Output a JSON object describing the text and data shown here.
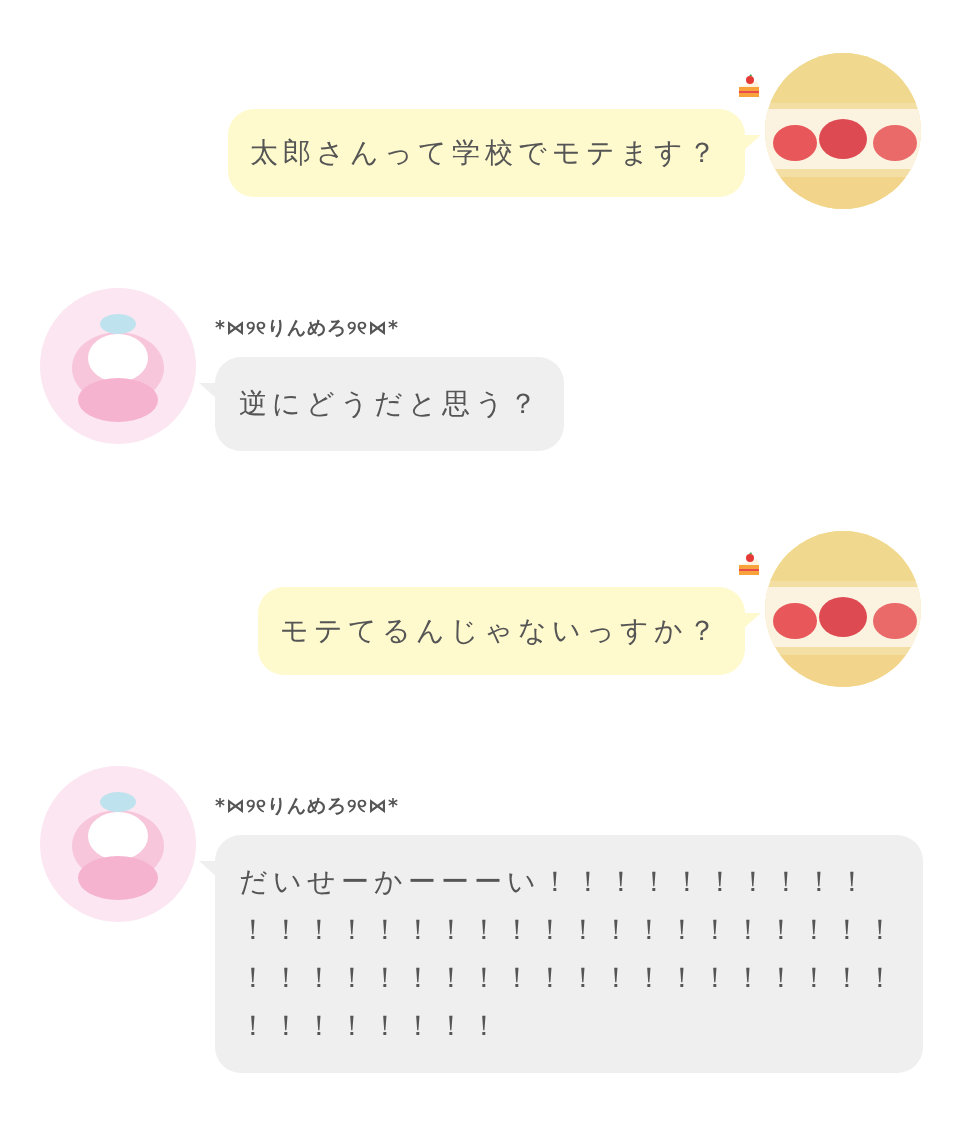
{
  "messages": [
    {
      "kind": "sent",
      "text": "太郎さんって学校でモテます？"
    },
    {
      "kind": "received",
      "sender": "*⋈୨୧りんめろ୨୧⋈*",
      "text": "逆にどうだと思う？"
    },
    {
      "kind": "sent",
      "text": "モテてるんじゃないっすか？"
    },
    {
      "kind": "received",
      "sender": "*⋈୨୧りんめろ୨୧⋈*",
      "text": "だいせーかーーーい！！！！！！！！！！！！！！！！！！！！！！！！！！！！！！！！！！！！！！！！！！！！！！！！！！！！！！！！！！"
    }
  ]
}
